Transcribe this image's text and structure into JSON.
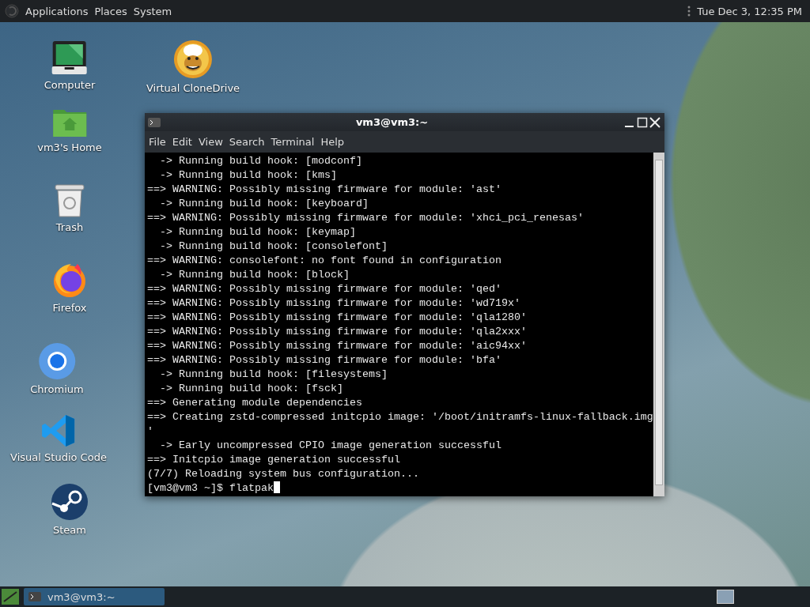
{
  "top_panel": {
    "menus": [
      "Applications",
      "Places",
      "System"
    ],
    "clock": "Tue Dec 3, 12:35 PM"
  },
  "desktop_icons": [
    {
      "kind": "computer",
      "label": "Computer"
    },
    {
      "kind": "disc",
      "label": "Virtual CloneDrive"
    },
    {
      "kind": "home",
      "label": "vm3's Home"
    },
    {
      "kind": "trash",
      "label": "Trash"
    },
    {
      "kind": "firefox",
      "label": "Firefox"
    },
    {
      "kind": "chromium",
      "label": "Chromium"
    },
    {
      "kind": "vscode",
      "label": "Visual Studio Code"
    },
    {
      "kind": "steam",
      "label": "Steam"
    }
  ],
  "terminal": {
    "title": "vm3@vm3:~",
    "menu": [
      "File",
      "Edit",
      "View",
      "Search",
      "Terminal",
      "Help"
    ],
    "lines": [
      "  -> Running build hook: [modconf]",
      "  -> Running build hook: [kms]",
      "==> WARNING: Possibly missing firmware for module: 'ast'",
      "  -> Running build hook: [keyboard]",
      "==> WARNING: Possibly missing firmware for module: 'xhci_pci_renesas'",
      "  -> Running build hook: [keymap]",
      "  -> Running build hook: [consolefont]",
      "==> WARNING: consolefont: no font found in configuration",
      "  -> Running build hook: [block]",
      "==> WARNING: Possibly missing firmware for module: 'qed'",
      "==> WARNING: Possibly missing firmware for module: 'wd719x'",
      "==> WARNING: Possibly missing firmware for module: 'qla1280'",
      "==> WARNING: Possibly missing firmware for module: 'qla2xxx'",
      "==> WARNING: Possibly missing firmware for module: 'aic94xx'",
      "==> WARNING: Possibly missing firmware for module: 'bfa'",
      "  -> Running build hook: [filesystems]",
      "  -> Running build hook: [fsck]",
      "==> Generating module dependencies",
      "==> Creating zstd-compressed initcpio image: '/boot/initramfs-linux-fallback.img",
      "'",
      "  -> Early uncompressed CPIO image generation successful",
      "==> Initcpio image generation successful",
      "(7/7) Reloading system bus configuration..."
    ],
    "prompt": "[vm3@vm3 ~]$ flatpak"
  },
  "taskbar": {
    "tasks": [
      {
        "label": "vm3@vm3:~",
        "selected": true
      }
    ]
  }
}
